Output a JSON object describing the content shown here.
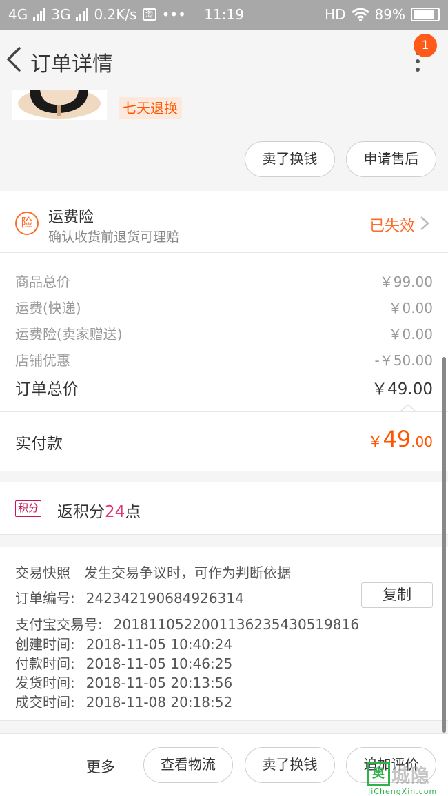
{
  "status_bar": {
    "network1": "4G",
    "network2": "3G",
    "speed": "0.2K/s",
    "taobao": "淘",
    "dots": "•••",
    "time": "11:19",
    "hd": "HD",
    "battery": "89%"
  },
  "header": {
    "title": "订单详情",
    "badge_count": "1"
  },
  "product": {
    "return_tag": "七天退换",
    "actions": [
      "卖了换钱",
      "申请售后"
    ]
  },
  "insurance": {
    "icon_label": "险",
    "title": "运费险",
    "subtitle": "确认收货前退货可理赔",
    "status": "已失效",
    "status_color": "#ff6a2a"
  },
  "price_summary": {
    "rows": [
      {
        "label": "商品总价",
        "value": "￥99.00"
      },
      {
        "label": "运费(快递)",
        "value": "￥0.00"
      },
      {
        "label": "运费险(卖家赠送)",
        "value": "￥0.00"
      },
      {
        "label": "店铺优惠",
        "value": "-￥50.00"
      }
    ],
    "total_label": "订单总价",
    "total_value": "￥49.00",
    "paid_label": "实付款",
    "paid_currency": "￥",
    "paid_int": "49",
    "paid_dec": ".00",
    "accent_color": "#ff5500"
  },
  "points": {
    "tag": "积分",
    "prefix": "返积分",
    "amount": "24",
    "suffix": "点"
  },
  "order_info": {
    "snapshot_label": "交易快照",
    "snapshot_desc": "发生交易争议时，可作为判断依据",
    "order_no_label": "订单编号:",
    "order_no": "242342190684926314",
    "copy_label": "复制",
    "alipay_label": "支付宝交易号:",
    "alipay_no": "2018110522001136235430519816",
    "created_label": "创建时间:",
    "created": "2018-11-05 10:40:24",
    "paid_label": "付款时间:",
    "paid": "2018-11-05 10:46:25",
    "shipped_label": "发货时间:",
    "shipped": "2018-11-05 20:13:56",
    "closed_label": "成交时间:",
    "closed": "2018-11-08 20:18:52"
  },
  "bottom_bar": {
    "more": "更多",
    "buttons": [
      "查看物流",
      "卖了换钱",
      "追加评价"
    ]
  },
  "watermark": {
    "box": "奥",
    "big": "城隐",
    "small": "JiChengXin.com"
  }
}
